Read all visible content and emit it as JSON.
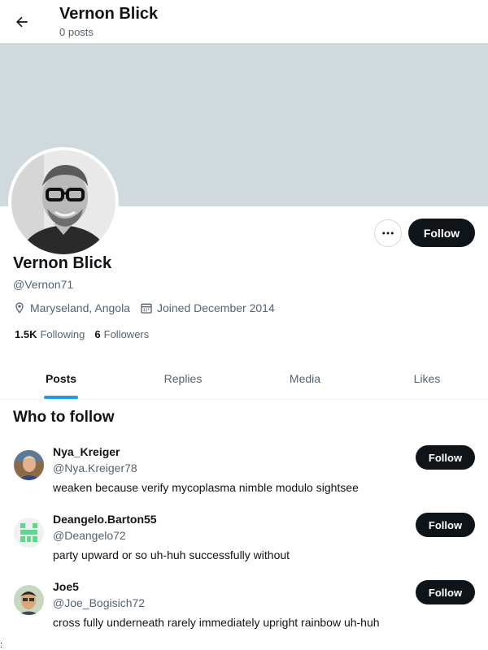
{
  "header": {
    "back_icon": "arrow-left-icon",
    "title": "Vernon Blick",
    "subtitle": "0 posts"
  },
  "profile": {
    "name": "Vernon Blick",
    "handle": "@Vernon71",
    "location": "Maryseland, Angola",
    "joined": "Joined December 2014",
    "following_count": "1.5K",
    "following_label": "Following",
    "followers_count": "6",
    "followers_label": "Followers",
    "follow_label": "Follow",
    "more_icon": "more-dots-icon"
  },
  "tabs": [
    {
      "label": "Posts",
      "active": true
    },
    {
      "label": "Replies",
      "active": false
    },
    {
      "label": "Media",
      "active": false
    },
    {
      "label": "Likes",
      "active": false
    }
  ],
  "who_to_follow": {
    "title": "Who to follow",
    "users": [
      {
        "name": "Nya_Kreiger",
        "handle": "@Nya.Kreiger78",
        "bio": "weaken because verify mycoplasma nimble modulo sightsee",
        "follow_label": "Follow"
      },
      {
        "name": "Deangelo.Barton55",
        "handle": "@Deangelo72",
        "bio": "party upward or so uh-huh successfully without",
        "follow_label": "Follow"
      },
      {
        "name": "Joe5",
        "handle": "@Joe_Bogisich72",
        "bio": "cross fully underneath rarely immediately upright rainbow uh-huh",
        "follow_label": "Follow"
      }
    ]
  },
  "colors": {
    "banner": "#cfd9de",
    "accent": "#1d9bf0",
    "button": "#0f1419",
    "secondary_text": "#536471"
  },
  "footer_mark": ":"
}
